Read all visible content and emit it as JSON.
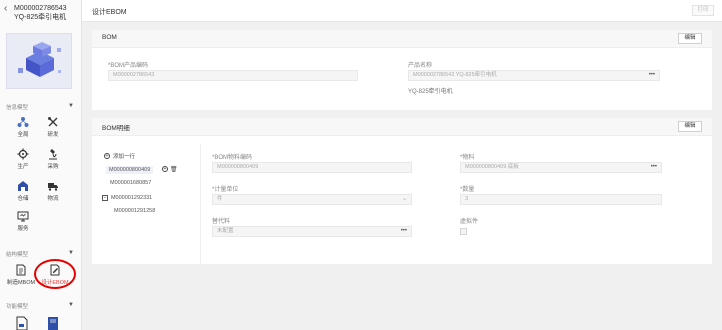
{
  "sidebar": {
    "back_icon": "chevron-left-icon",
    "title_line1": "M000002786543",
    "title_line2": "YQ-825牵引电机",
    "section_info": "信息模型",
    "items_info": [
      {
        "label": "全局",
        "icon": "network-icon"
      },
      {
        "label": "研发",
        "icon": "tools-icon"
      },
      {
        "label": "生产",
        "icon": "gears-icon"
      },
      {
        "label": "采购",
        "icon": "microscope-icon"
      },
      {
        "label": "仓储",
        "icon": "warehouse-icon"
      },
      {
        "label": "物流",
        "icon": "truck-icon"
      },
      {
        "label": "服务",
        "icon": "service-icon"
      }
    ],
    "section_struct": "结构模型",
    "items_struct": [
      {
        "label": "制造MBOM",
        "icon": "document-icon"
      },
      {
        "label": "设计EBOM",
        "icon": "document-edit-icon"
      }
    ],
    "section_func": "功能模型"
  },
  "topbar": {
    "title": "设计EBOM",
    "print_label": "打印"
  },
  "bom_card": {
    "title": "BOM",
    "edit_label": "编辑",
    "code_label": "*BOM产品编码",
    "code_value": "M000002786543",
    "name_label": "产品名称",
    "name_value": "M000002786543 YQ-825牵引电机",
    "name_sub": "YQ-825牵引电机"
  },
  "detail_card": {
    "title": "BOM明细",
    "edit_label": "编辑",
    "add_row_label": "添加一行",
    "tree": [
      {
        "label": "M000000800409",
        "selected": true
      },
      {
        "label": "M000001680857"
      },
      {
        "label": "M000001292331",
        "expanded": true
      },
      {
        "label": "M000001291258"
      }
    ],
    "material_code_label": "*BOM物料编码",
    "material_code_value": "M000000800409",
    "material_label": "*物料",
    "material_value": "M000000800409 底板",
    "unit_label": "*计量单位",
    "unit_value": "件",
    "qty_label": "*数量",
    "qty_value": "3",
    "substitute_label": "替代料",
    "substitute_value": "未配置",
    "phantom_label": "虚拟件"
  }
}
